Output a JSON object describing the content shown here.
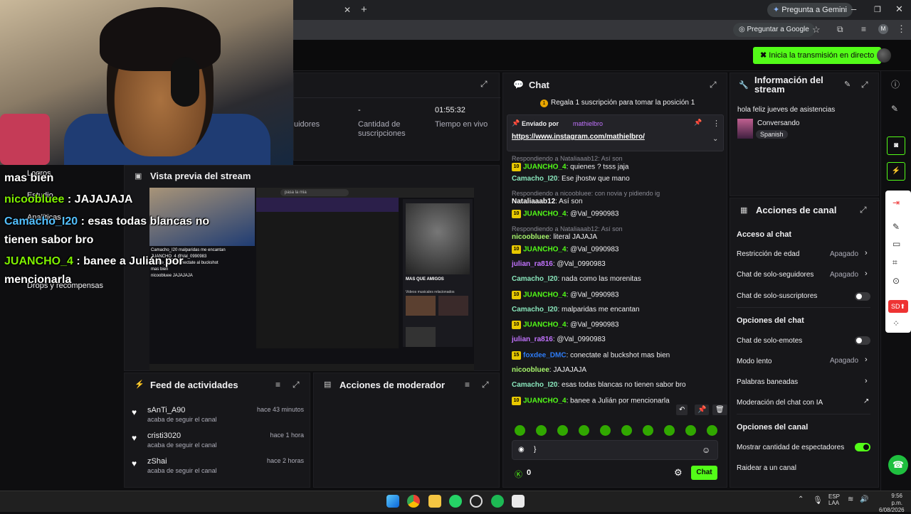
{
  "browser": {
    "gemini": "Pregunta a Gemini",
    "ask_google": "Preguntar a Google",
    "profile_initial": "M"
  },
  "topbar": {
    "go_live": "Inicia la transmisión en directo"
  },
  "stats": {
    "followers_label": "uidores",
    "subs_value": "-",
    "subs_label": "Cantidad de suscripciones",
    "time_value": "01:55:32",
    "time_label": "Tiempo en vivo"
  },
  "overlay": {
    "lines": [
      {
        "name": "",
        "text": "mas bien"
      },
      {
        "name": "nicoobluee",
        "text": " : JAJAJAJA"
      },
      {
        "name": "Camacho_I20",
        "text": " : esas todas blancas no"
      },
      {
        "name": "",
        "text": "tienen sabor bro"
      },
      {
        "name": "JUANCHO_4",
        "text": " : banee a Julián por"
      },
      {
        "name": "",
        "text": "mencionarla"
      }
    ],
    "sidebar_items": [
      "Logros",
      "Estudio",
      "Analíticas",
      "Drops y recompensas"
    ]
  },
  "preview": {
    "title": "Vista previa del stream",
    "spotify_search": "pasa la mia",
    "spotify_title": "MAS QUE AMIGOS",
    "spotify_sub": "Videos musicales relacionados",
    "overlay_lines": [
      "Camacho_I20 malparidas me encantan",
      "JUANCHO_4 @Val_0990983",
      "foxdee_DMC conectate al buckshot",
      "mas bien",
      "nicoobluee JAJAJAJA"
    ]
  },
  "feed": {
    "title": "Feed de actividades",
    "items": [
      {
        "user": "sAnTi_A90",
        "time": "hace 43 minutos",
        "action": "acaba de seguir el canal"
      },
      {
        "user": "cristi3020",
        "time": "hace 1 hora",
        "action": "acaba de seguir el canal"
      },
      {
        "user": "zShai",
        "time": "hace 2 horas",
        "action": "acaba de seguir el canal"
      }
    ]
  },
  "mod": {
    "title": "Acciones de moderador"
  },
  "chat": {
    "title": "Chat",
    "gift_banner": "Regala 1 suscripción para tomar la posición 1",
    "pinned_by": "Enviado por",
    "pinned_user": "mathielbro",
    "pinned_link": "https://www.instagram.com/mathielbro/",
    "messages": [
      {
        "reply": "Respondiendo a Nataliaaab12: Así son",
        "badge": "10",
        "user": "JUANCHO_4",
        "text": "quienes ? tsss jaja",
        "cls": "n-green"
      },
      {
        "user": "Camacho_I20",
        "text": "Ese jhostw que mano",
        "cls": "n-teal"
      },
      {
        "reply": "Respondiendo a nicoobluee: con novia y pidiendo ig",
        "user": "Nataliaaab12",
        "text": "Así son",
        "cls": "n-white"
      },
      {
        "badge": "10",
        "user": "JUANCHO_4",
        "text": "@Val_0990983",
        "cls": "n-green"
      },
      {
        "reply": "Respondiendo a Nataliaaab12: Así son",
        "user": "nicoobluee",
        "text": "literal JAJAJA",
        "cls": "n-lime"
      },
      {
        "badge": "10",
        "user": "JUANCHO_4",
        "text": "@Val_0990983",
        "cls": "n-green"
      },
      {
        "user": "julian_ra816",
        "text": "@Val_0990983",
        "cls": "n-purple"
      },
      {
        "user": "Camacho_I20",
        "text": "nada como las morenitas",
        "cls": "n-teal"
      },
      {
        "badge": "10",
        "user": "JUANCHO_4",
        "text": "@Val_0990983",
        "cls": "n-green"
      },
      {
        "user": "Camacho_I20",
        "text": "malparidas me encantan",
        "cls": "n-teal"
      },
      {
        "badge": "10",
        "user": "JUANCHO_4",
        "text": "@Val_0990983",
        "cls": "n-green"
      },
      {
        "user": "julian_ra816",
        "text": "@Val_0990983",
        "cls": "n-purple"
      },
      {
        "badge": "15",
        "user": "foxdee_DMC",
        "text": "conectate al buckshot mas bien",
        "cls": "n-blue"
      },
      {
        "user": "nicoobluee",
        "text": "JAJAJAJA",
        "cls": "n-lime"
      },
      {
        "user": "Camacho_I20",
        "text": "esas todas blancas no tienen sabor bro",
        "cls": "n-teal"
      },
      {
        "badge": "10",
        "user": "JUANCHO_4",
        "text": "banee a Julián por mencionarla",
        "cls": "n-green"
      }
    ],
    "input_value": "}",
    "points": "0",
    "send_label": "Chat"
  },
  "info": {
    "title": "Información del stream",
    "stream_title": "hola feliz jueves de asistencias",
    "category": "Conversando",
    "language": "Spanish"
  },
  "actions": {
    "title": "Acciones de canal",
    "chat_access_title": "Acceso al chat",
    "age_restriction": "Restricción de edad",
    "age_value": "Apagado",
    "followers_only": "Chat de solo-seguidores",
    "followers_value": "Apagado",
    "subs_only": "Chat de solo-suscriptores",
    "chat_options_title": "Opciones del chat",
    "emotes_only": "Chat de solo-emotes",
    "slow_mode": "Modo lento",
    "slow_value": "Apagado",
    "banned_words": "Palabras baneadas",
    "ai_moderation": "Moderación del chat con IA",
    "channel_options_title": "Opciones del canal",
    "show_viewers": "Mostrar cantidad de espectadores",
    "raid": "Raidear a un canal"
  },
  "taskbar": {
    "lang1": "ESP",
    "lang2": "LAA",
    "time": "9:56 p.m.",
    "date": "6/08/2026"
  },
  "colors": {
    "accent": "#53fc18",
    "bg": "#0e0e10",
    "panel": "#17171a"
  }
}
